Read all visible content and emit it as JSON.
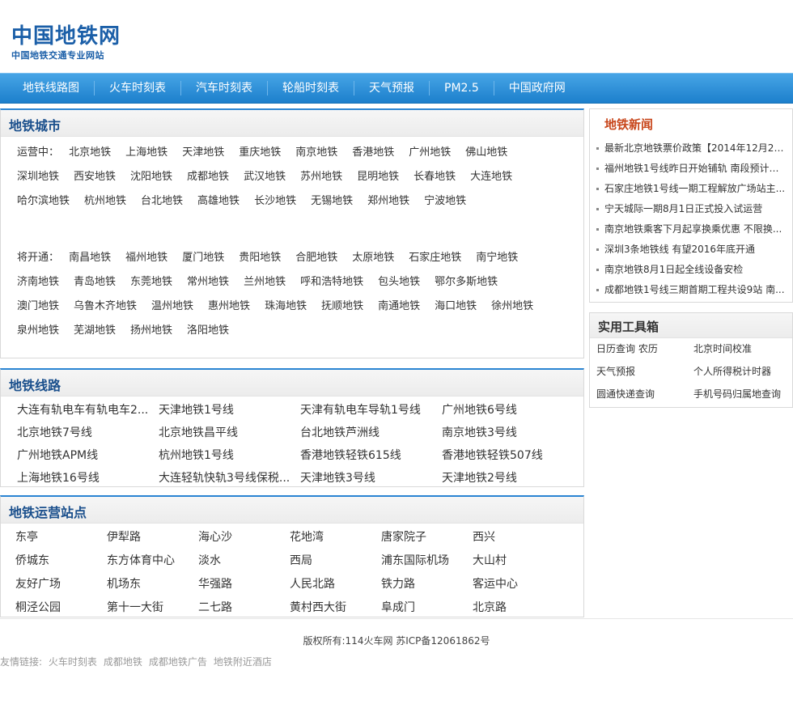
{
  "logo": {
    "main": "中国地铁网",
    "sub": "中国地铁交通专业网站"
  },
  "nav": [
    "地铁线路图",
    "火车时刻表",
    "汽车时刻表",
    "轮船时刻表",
    "天气预报",
    "PM2.5",
    "中国政府网"
  ],
  "cities": {
    "title": "地铁城市",
    "operating_label": "运营中：",
    "operating": [
      "北京地铁",
      "上海地铁",
      "天津地铁",
      "重庆地铁",
      "南京地铁",
      "香港地铁",
      "广州地铁",
      "佛山地铁",
      "深圳地铁",
      "西安地铁",
      "沈阳地铁",
      "成都地铁",
      "武汉地铁",
      "苏州地铁",
      "昆明地铁",
      "长春地铁",
      "大连地铁",
      "哈尔滨地铁",
      "杭州地铁",
      "台北地铁",
      "高雄地铁",
      "长沙地铁",
      "无锡地铁",
      "郑州地铁",
      "宁波地铁"
    ],
    "upcoming_label": "将开通：",
    "upcoming": [
      "南昌地铁",
      "福州地铁",
      "厦门地铁",
      "贵阳地铁",
      "合肥地铁",
      "太原地铁",
      "石家庄地铁",
      "南宁地铁",
      "济南地铁",
      "青岛地铁",
      "东莞地铁",
      "常州地铁",
      "兰州地铁",
      "呼和浩特地铁",
      "包头地铁",
      "鄂尔多斯地铁",
      "澳门地铁",
      "乌鲁木齐地铁",
      "温州地铁",
      "惠州地铁",
      "珠海地铁",
      "抚顺地铁",
      "南通地铁",
      "海口地铁",
      "徐州地铁",
      "泉州地铁",
      "芜湖地铁",
      "扬州地铁",
      "洛阳地铁"
    ]
  },
  "lines": {
    "title": "地铁线路",
    "rows": [
      [
        "大连有轨电车有轨电车2...",
        "天津地铁1号线",
        "天津有轨电车导轨1号线",
        "广州地铁6号线"
      ],
      [
        "北京地铁7号线",
        "北京地铁昌平线",
        "台北地铁芦洲线",
        "南京地铁3号线"
      ],
      [
        "广州地铁APM线",
        "杭州地铁1号线",
        "香港地铁轻铁615线",
        "香港地铁轻铁507线"
      ],
      [
        "上海地铁16号线",
        "大连轻轨快轨3号线保税...",
        "天津地铁3号线",
        "天津地铁2号线"
      ]
    ]
  },
  "stations": {
    "title": "地铁运营站点",
    "rows": [
      [
        "东亭",
        "伊犁路",
        "海心沙",
        "花地湾",
        "唐家院子",
        "西兴"
      ],
      [
        "侨城东",
        "东方体育中心",
        "淡水",
        "西局",
        "浦东国际机场",
        "大山村"
      ],
      [
        "友好广场",
        "机场东",
        "华强路",
        "人民北路",
        "铁力路",
        "客运中心"
      ],
      [
        "桐泾公园",
        "第十一大街",
        "二七路",
        "黄村西大街",
        "阜成门",
        "北京路"
      ]
    ]
  },
  "news": {
    "title": "地铁新闻",
    "items": [
      "最新北京地铁票价政策【2014年12月28...",
      "福州地铁1号线昨日开始铺轨 南段预计明...",
      "石家庄地铁1号线一期工程解放广场站主...",
      "宁天城际一期8月1日正式投入试运营",
      "南京地铁乘客下月起享换乘优惠 不限换...",
      "深圳3条地铁线 有望2016年底开通",
      "南京地铁8月1日起全线设备安检",
      "成都地铁1号线三期首期工程共设9站 南..."
    ]
  },
  "tools": {
    "title": "实用工具箱",
    "rows": [
      [
        "日历查询 农历",
        "北京时间校准"
      ],
      [
        "天气预报",
        "个人所得税计时器"
      ],
      [
        "圆通快递查询",
        "手机号码归属地查询"
      ]
    ]
  },
  "footer": {
    "copyright": "版权所有:114火车网 苏ICP备12061862号",
    "friend_label": "友情链接:",
    "friend_links": [
      "火车时刻表",
      "成都地铁",
      "成都地铁广告",
      "地铁附近酒店"
    ]
  }
}
